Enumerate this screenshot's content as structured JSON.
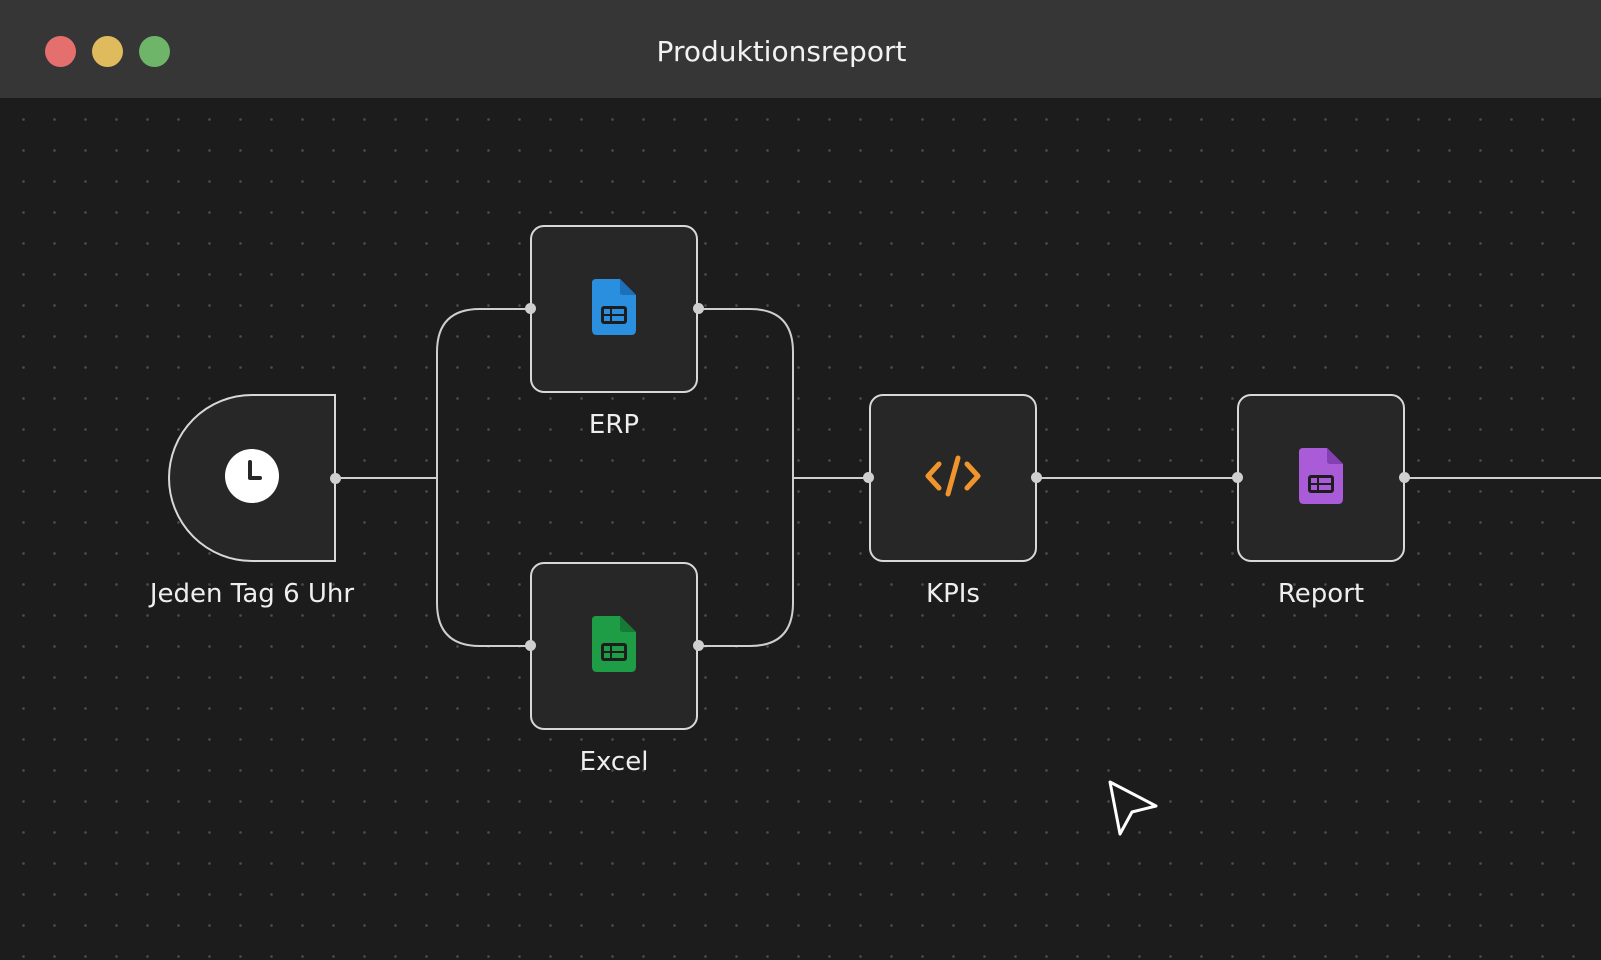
{
  "window": {
    "title": "Produktionsreport"
  },
  "workflow": {
    "nodes": [
      {
        "id": "trigger",
        "label": "Jeden Tag 6 Uhr",
        "icon": "clock-icon"
      },
      {
        "id": "erp",
        "label": "ERP",
        "icon": "spreadsheet-icon",
        "color": "#2b8fe0"
      },
      {
        "id": "excel",
        "label": "Excel",
        "icon": "spreadsheet-icon",
        "color": "#1e9c46"
      },
      {
        "id": "kpis",
        "label": "KPIs",
        "icon": "code-icon",
        "color": "#f0952e"
      },
      {
        "id": "report",
        "label": "Report",
        "icon": "spreadsheet-icon",
        "color": "#a95bd8"
      }
    ],
    "connections": [
      [
        "trigger",
        "erp"
      ],
      [
        "trigger",
        "excel"
      ],
      [
        "erp",
        "kpis"
      ],
      [
        "excel",
        "kpis"
      ],
      [
        "kpis",
        "report"
      ],
      [
        "report",
        "next"
      ]
    ]
  },
  "colors": {
    "background": "#1c1c1d",
    "titlebar": "#363636",
    "node_fill": "#272728",
    "node_border": "#d8d8d8",
    "edge": "#cfcfcf"
  }
}
